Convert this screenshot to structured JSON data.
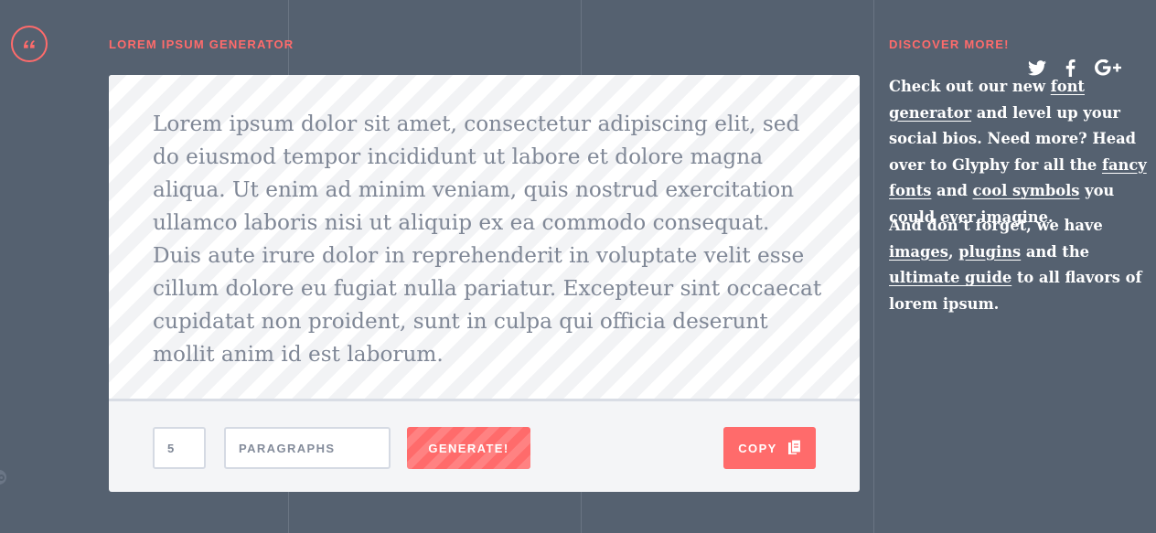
{
  "generator": {
    "label": "LOREM IPSUM GENERATOR",
    "text": "Lorem ipsum dolor sit amet, consectetur adipiscing elit, sed do eiusmod tempor incididunt ut labore et dolore magna aliqua. Ut enim ad minim veniam, quis nostrud exercitation ullamco laboris nisi ut aliquip ex ea commodo consequat. Duis aute irure dolor in reprehenderit in voluptate velit esse cillum dolore eu fugiat nulla pariatur. Excepteur sint occaecat cupidatat non proident, sunt in culpa qui officia deserunt mollit anim id est laborum.",
    "count_value": "5",
    "unit_value": "PARAGRAPHS",
    "generate_label": "GENERATE!",
    "copy_label": "COPY"
  },
  "sidebar": {
    "label": "DISCOVER MORE!",
    "social_icons": [
      "twitter-icon",
      "facebook-icon",
      "google-plus-icon"
    ],
    "p1": {
      "t1": "Check out our new ",
      "link_font_generator": "font generator",
      "t2": " and level up your social bios. Need more? Head over to Glyphy for all the ",
      "link_fancy_fonts": "fancy fonts",
      "t3": " and ",
      "link_cool_symbols": "cool symbols",
      "t4": " you could ever imagine."
    },
    "p2": {
      "t1": "And don’t forget, we have ",
      "link_images": "images",
      "t2": ", ",
      "link_plugins": "plugins",
      "t3": " and the ",
      "link_ultimate_guide": "ultimate guide",
      "t4": " to all flavors of lorem ipsum."
    }
  },
  "colors": {
    "background": "#556170",
    "accent": "#ff6b6b",
    "card": "#ffffff",
    "text": "#7f8796"
  }
}
